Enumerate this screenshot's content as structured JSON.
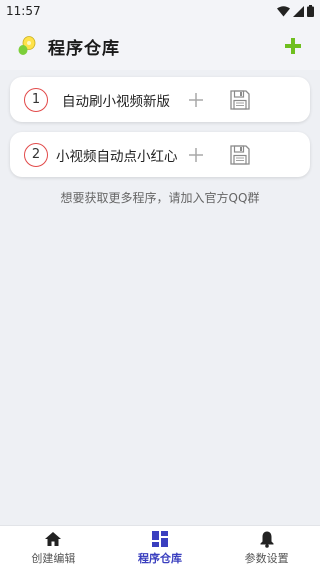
{
  "status_bar": {
    "time": "11:57"
  },
  "app_bar": {
    "title": "程序仓库"
  },
  "programs": [
    {
      "number": "1",
      "title": "自动刷小视频新版"
    },
    {
      "number": "2",
      "title": "小视频自动点小红心"
    }
  ],
  "hint": "想要获取更多程序，请加入官方QQ群",
  "bottom_nav": [
    {
      "label": "创建编辑",
      "icon": "home-icon"
    },
    {
      "label": "程序仓库",
      "icon": "grid-icon",
      "active": true
    },
    {
      "label": "参数设置",
      "icon": "bell-icon"
    }
  ],
  "colors": {
    "accent_green": "#6fbf1f",
    "active_nav": "#3a3fbf",
    "badge_red": "#e24a4a"
  }
}
